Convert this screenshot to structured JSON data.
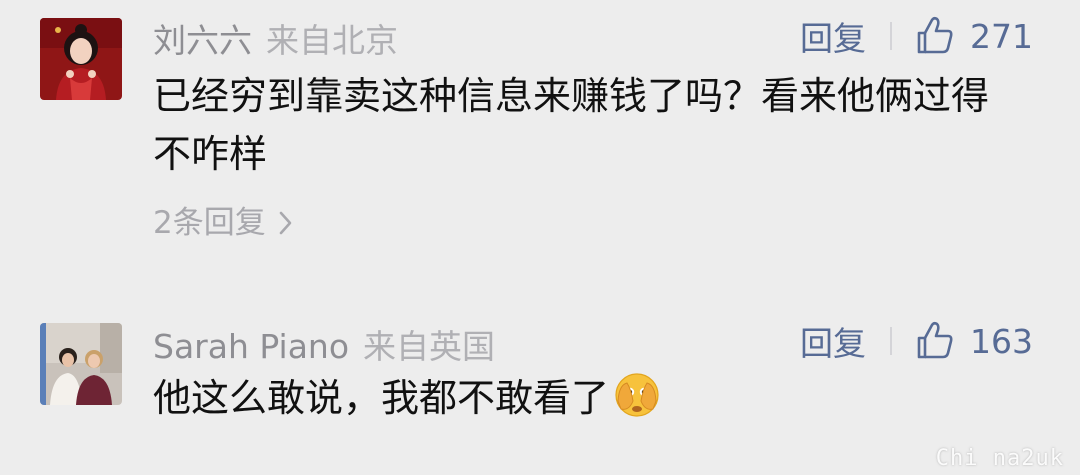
{
  "comments": [
    {
      "username": "刘六六",
      "location": "来自北京",
      "reply_label": "回复",
      "likes": "271",
      "text": "已经穷到靠卖这种信息来赚钱了吗？看来他俩过得不咋样",
      "more_replies": "2条回复",
      "avatar_icon": "user-avatar-woman-red-dress"
    },
    {
      "username": "Sarah Piano",
      "location": "来自英国",
      "reply_label": "回复",
      "likes": "163",
      "text": "他这么敢说，我都不敢看了",
      "emoji": "hands-over-eyes-emoji",
      "avatar_icon": "user-avatar-two-women-photo"
    }
  ],
  "watermark": "Chi na2uk",
  "colors": {
    "background": "#ededed",
    "link_blue": "#576b95",
    "meta_gray": "#8e8e93",
    "text": "#111111"
  }
}
